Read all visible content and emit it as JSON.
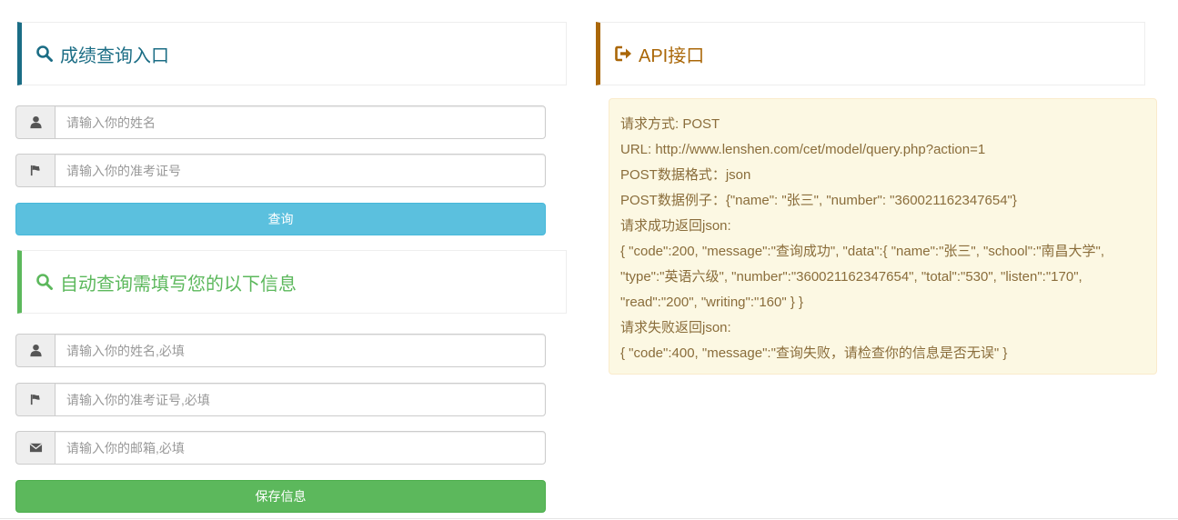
{
  "query_panel": {
    "title": "成绩查询入口",
    "icon": "search-icon",
    "color": "#1b6d85",
    "name_placeholder": "请输入你的姓名",
    "number_placeholder": "请输入你的准考证号",
    "submit_label": "查询"
  },
  "auto_panel": {
    "title": "自动查询需填写您的以下信息",
    "icon": "search-icon",
    "color": "#5cb85c",
    "name_placeholder": "请输入你的姓名,必填",
    "number_placeholder": "请输入你的准考证号,必填",
    "email_placeholder": "请输入你的邮箱,必填",
    "save_label": "保存信息"
  },
  "api_panel": {
    "title": "API接口",
    "icon": "sign-out-icon",
    "color": "#aa6708",
    "lines": [
      "请求方式: POST",
      "URL: http://www.lenshen.com/cet/model/query.php?action=1",
      "POST数据格式：json",
      "POST数据例子：{\"name\": \"张三\", \"number\": \"360021162347654\"}",
      "请求成功返回json:",
      "{ \"code\":200, \"message\":\"查询成功\", \"data\":{ \"name\":\"张三\", \"school\":\"南昌大学\",",
      "\"type\":\"英语六级\", \"number\":\"360021162347654\", \"total\":\"530\", \"listen\":\"170\",",
      "\"read\":\"200\", \"writing\":\"160\" } }",
      "请求失败返回json:",
      "{ \"code\":400, \"message\":\"查询失败，请检查你的信息是否无误\" }"
    ]
  }
}
